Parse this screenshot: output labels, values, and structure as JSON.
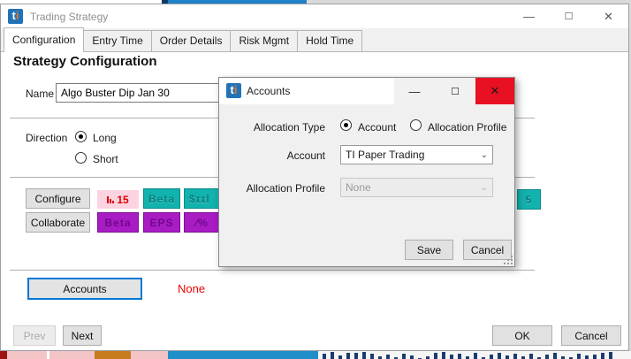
{
  "window": {
    "title": "Trading Strategy",
    "logo_t": "t",
    "logo_i": "i",
    "controls": {
      "minimize": "—",
      "maximize": "☐",
      "close": "✕"
    },
    "tabs": [
      {
        "label": "Configuration",
        "active": true
      },
      {
        "label": "Entry Time",
        "active": false
      },
      {
        "label": "Order Details",
        "active": false
      },
      {
        "label": "Risk Mgmt",
        "active": false
      },
      {
        "label": "Hold Time",
        "active": false
      }
    ],
    "heading": "Strategy Configuration",
    "name_field": {
      "label": "Name",
      "value": "Algo Buster Dip Jan 30"
    },
    "direction": {
      "label": "Direction",
      "options": [
        {
          "label": "Long",
          "selected": true
        },
        {
          "label": "Short",
          "selected": false
        }
      ]
    },
    "configure_button": "Configure",
    "collaborate_button": "Collaborate",
    "badges_row1": [
      {
        "icon": "bar-chart-icon",
        "text": "15",
        "style": "pink"
      },
      {
        "text": "Beta",
        "style": "teal"
      },
      {
        "text": "$ɪɪl",
        "style": "teal"
      },
      {
        "text": "5",
        "style": "teal"
      }
    ],
    "badges_row2": [
      {
        "text": "Beta",
        "style": "purple"
      },
      {
        "text": "EPS",
        "style": "purple"
      },
      {
        "text": "∕%",
        "style": "purple"
      }
    ],
    "accounts": {
      "button": "Accounts",
      "status": "None"
    },
    "footer": {
      "prev": "Prev",
      "next": "Next",
      "ok": "OK",
      "cancel": "Cancel"
    }
  },
  "dialog": {
    "title": "Accounts",
    "logo_t": "t",
    "logo_i": "i",
    "controls": {
      "minimize": "—",
      "maximize": "☐",
      "close": "✕"
    },
    "allocation_type": {
      "label": "Allocation Type",
      "options": [
        {
          "label": "Account",
          "selected": true
        },
        {
          "label": "Allocation Profile",
          "selected": false
        }
      ]
    },
    "account_field": {
      "label": "Account",
      "value": "TI Paper Trading",
      "disabled": false
    },
    "allocation_profile_field": {
      "label": "Allocation Profile",
      "value": "None",
      "disabled": true
    },
    "save_button": "Save",
    "cancel_button": "Cancel",
    "chevron": "⌄"
  },
  "colors": {
    "accent_blue": "#0078d7",
    "close_red": "#e81123",
    "status_red": "#ee0000",
    "badge_teal": "#12b2ae",
    "badge_purple": "#a81cc4",
    "badge_pink": "#fcd3e1",
    "logo_blue": "#2272b8",
    "logo_orange": "#e87722"
  },
  "desktop": {
    "volume_bars": [
      6,
      8,
      4,
      7,
      7,
      8,
      6,
      3,
      5,
      2,
      6,
      4,
      1,
      3,
      7,
      8,
      5,
      6,
      3,
      7,
      2,
      5,
      7,
      4,
      6,
      3,
      6,
      2,
      5,
      7,
      3,
      2,
      6,
      4,
      5,
      7,
      8
    ]
  }
}
